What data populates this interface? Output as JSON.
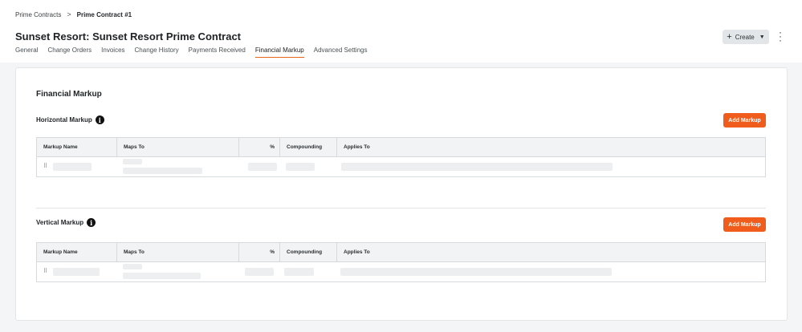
{
  "breadcrumb": {
    "parent": "Prime Contracts",
    "separator": ">",
    "current": "Prime Contract #1"
  },
  "page_title": "Sunset Resort: Sunset Resort Prime Contract",
  "header_actions": {
    "create_label": "Create",
    "create_icon": "plus-icon",
    "more_icon": "kebab-icon"
  },
  "tabs": [
    {
      "label": "General",
      "active": false
    },
    {
      "label": "Change Orders",
      "active": false
    },
    {
      "label": "Invoices",
      "active": false
    },
    {
      "label": "Change History",
      "active": false
    },
    {
      "label": "Payments Received",
      "active": false
    },
    {
      "label": "Financial Markup",
      "active": true
    },
    {
      "label": "Advanced Settings",
      "active": false
    }
  ],
  "main": {
    "title": "Financial Markup",
    "horizontal": {
      "title": "Horizontal Markup",
      "add_label": "Add Markup",
      "columns": [
        "Markup Name",
        "Maps To",
        "%",
        "Compounding",
        "Applies To"
      ]
    },
    "vertical": {
      "title": "Vertical Markup",
      "add_label": "Add Markup",
      "columns": [
        "Markup Name",
        "Maps To",
        "%",
        "Compounding",
        "Applies To"
      ]
    }
  },
  "colors": {
    "accent": "#f05c1c",
    "tab_underline": "#e8661c"
  }
}
